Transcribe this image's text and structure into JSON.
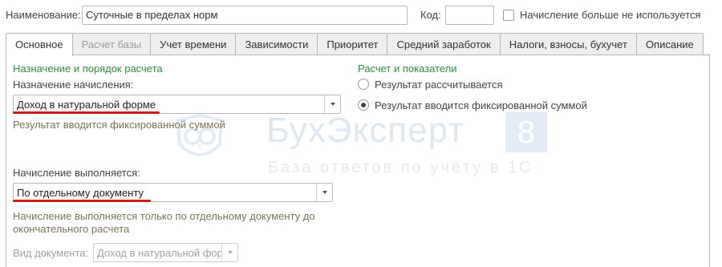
{
  "header": {
    "name_label": "Наименование:",
    "name_value": "Суточные в пределах норм",
    "code_label": "Код:",
    "code_value": "",
    "not_used_label": "Начисление больше не используется"
  },
  "tabs": [
    {
      "label": "Основное"
    },
    {
      "label": "Расчет базы"
    },
    {
      "label": "Учет времени"
    },
    {
      "label": "Зависимости"
    },
    {
      "label": "Приоритет"
    },
    {
      "label": "Средний заработок"
    },
    {
      "label": "Налоги, взносы, бухучет"
    },
    {
      "label": "Описание"
    }
  ],
  "main": {
    "purpose_group_title": "Назначение и порядок расчета",
    "purpose_label": "Назначение начисления:",
    "purpose_value": "Доход в натуральной форме",
    "purpose_hint": "Результат вводится фиксированной суммой",
    "execution_label": "Начисление выполняется:",
    "execution_value": "По отдельному документу",
    "execution_hint_line1": "Начисление выполняется только по отдельному документу до",
    "execution_hint_line2": "окончательного расчета",
    "doc_type_label": "Вид документа:",
    "doc_type_value": "Доход в натуральной фор"
  },
  "calc": {
    "group_title": "Расчет и показатели",
    "radio_calculated": "Результат рассчитывается",
    "radio_fixed": "Результат вводится фиксированной суммой",
    "selected": "fixed"
  },
  "watermark": {
    "title": "БухЭксперт",
    "badge": "8",
    "subtitle": "База ответов по учёту в 1С"
  },
  "colors": {
    "group_title": "#2f8c3f",
    "hint": "#7b7357",
    "underline": "#d21a1a",
    "watermark": "#dfe7f0"
  }
}
